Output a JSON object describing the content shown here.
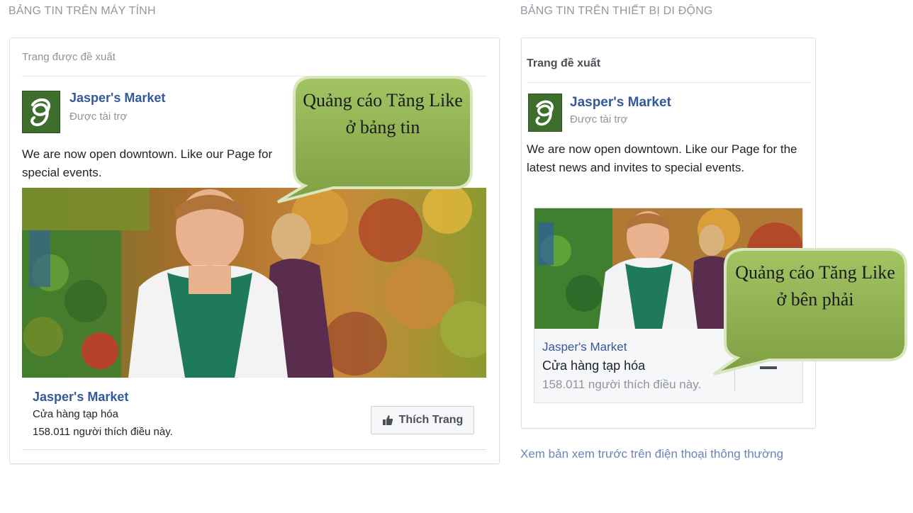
{
  "desktop": {
    "section_title": "BẢNG TIN TRÊN MÁY TÍNH",
    "card_header": "Trang được đề xuất",
    "page_name": "Jasper's Market",
    "sponsored": "Được tài trợ",
    "body_text": "We are now open downtown. Like our Page for special events.",
    "footer_name": "Jasper's Market",
    "footer_category": "Cửa hàng tạp hóa",
    "footer_likes": "158.011 người thích điều này.",
    "like_button": "Thích Trang"
  },
  "mobile": {
    "section_title": "BẢNG TIN TRÊN THIẾT BỊ DI ĐỘNG",
    "card_header": "Trang đề xuất",
    "page_name": "Jasper's Market",
    "sponsored": "Được tài trợ",
    "body_text": "We are now open downtown. Like our Page for the latest news and invites to special events.",
    "footer_name": "Jasper's Market",
    "footer_category": "Cửa hàng tạp hóa",
    "footer_likes": "158.011 người thích điều này.",
    "preview_link": "Xem bản xem trước trên điện thoại thông thường"
  },
  "callouts": {
    "newsfeed": "Quảng cáo Tăng Like ở bảng tin",
    "right_column": "Quảng cáo Tăng Like ở bên phải"
  },
  "colors": {
    "link_blue": "#365899",
    "muted_gray": "#90949c",
    "callout_green": "#8db04f",
    "logo_green": "#3e6e2b"
  }
}
